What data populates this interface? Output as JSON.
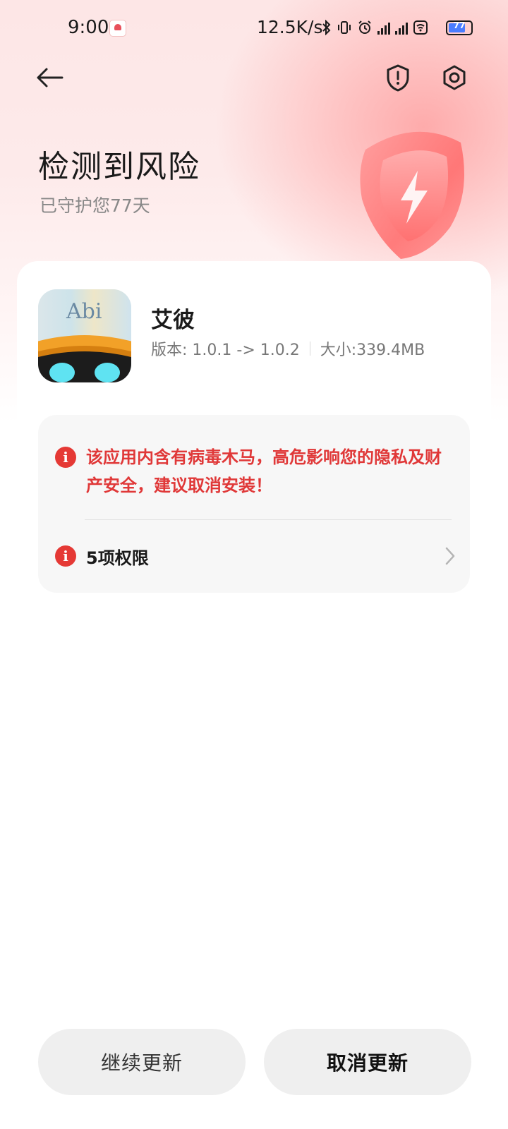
{
  "status_bar": {
    "time": "9:00",
    "network_speed": "12.5K/s",
    "battery": "77"
  },
  "header": {
    "title": "检测到风险",
    "subtitle": "已守护您77天"
  },
  "app": {
    "name": "艾彼",
    "icon_text": "Abi",
    "version": "版本: 1.0.1 -> 1.0.2",
    "size": "大小:339.4MB"
  },
  "warning": {
    "message": "该应用内含有病毒木马，高危影响您的隐私及财产安全，建议取消安装！",
    "permissions": "5项权限"
  },
  "buttons": {
    "continue": "继续更新",
    "cancel": "取消更新"
  },
  "colors": {
    "danger": "#e53935",
    "battery": "#4a7cff"
  },
  "battery_level": 0.77
}
